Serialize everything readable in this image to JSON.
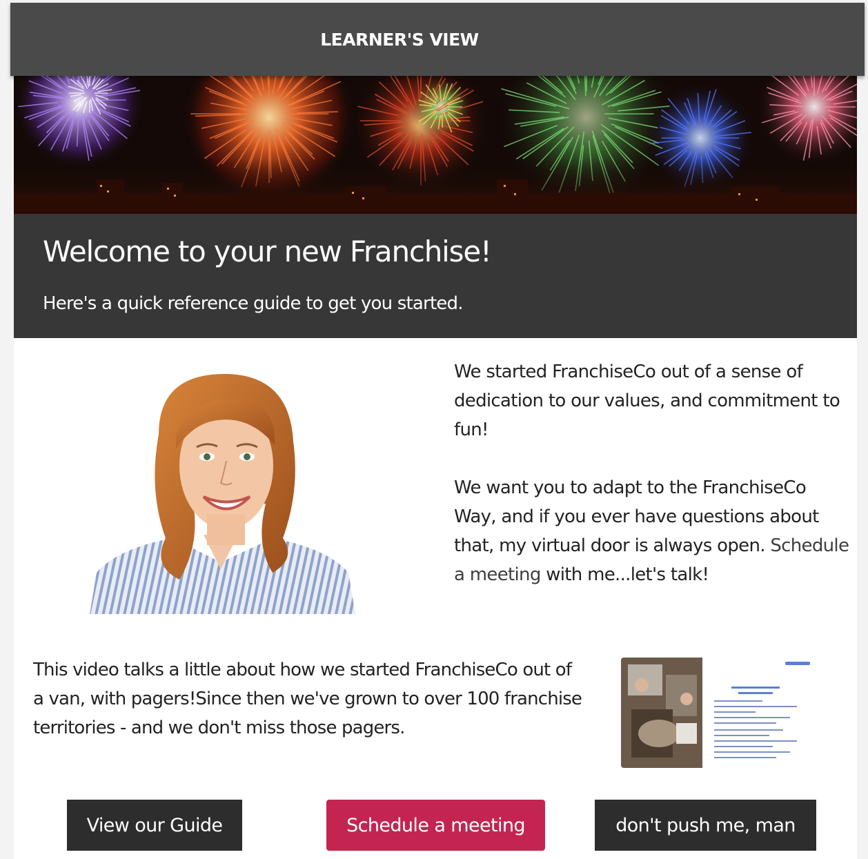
{
  "header": {
    "title": "LEARNER'S VIEW"
  },
  "banner": {
    "image": "fireworks-banner"
  },
  "welcome": {
    "title": "Welcome to your new Franchise!",
    "subtitle": "Here's a quick reference guide to get you started."
  },
  "intro": {
    "portrait": "smiling-woman-portrait",
    "paragraph1": "We started FranchiseCo out of a sense of dedication to our values, and commitment to fun!",
    "paragraph2_before": "We want you to adapt to the FranchiseCo Way, and if you ever have questions about that, my virtual door is always open. ",
    "paragraph2_link": "Schedule a meeting",
    "paragraph2_after": " with me...let's talk!"
  },
  "video": {
    "description": "This video talks a little about how we started FranchiseCo out of a van, with pagers!Since then we've grown to over 100 franchise territories - and we don't miss those pagers.",
    "thumbnail": "video-thumbnail"
  },
  "buttons": {
    "guide": "View our Guide",
    "meeting": "Schedule a meeting",
    "push": "don't push me, man"
  },
  "colors": {
    "header_bg": "#4a4a4a",
    "welcome_bg": "#373737",
    "primary_button": "#c42451",
    "dark_button": "#2d2d2d"
  }
}
